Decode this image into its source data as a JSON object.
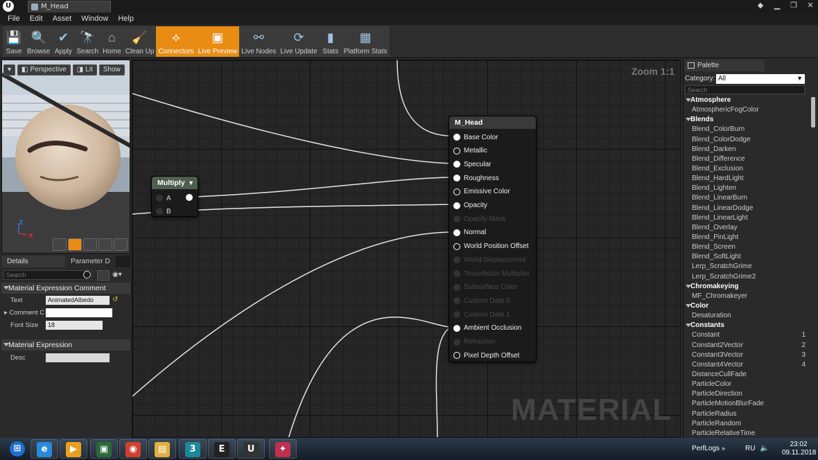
{
  "window": {
    "tab_title": "M_Head",
    "logo": "U"
  },
  "menu": [
    "File",
    "Edit",
    "Asset",
    "Window",
    "Help"
  ],
  "toolbar": [
    {
      "label": "Save",
      "icon": "save-icon",
      "active": false
    },
    {
      "label": "Browse",
      "icon": "browse-icon",
      "active": false
    },
    {
      "label": "Apply",
      "icon": "apply-icon",
      "active": false
    },
    {
      "label": "Search",
      "icon": "search-icon",
      "active": false
    },
    {
      "label": "Home",
      "icon": "home-icon",
      "active": false
    },
    {
      "label": "Clean Up",
      "icon": "cleanup-icon",
      "active": false
    },
    {
      "label": "Connectors",
      "icon": "connectors-icon",
      "active": true
    },
    {
      "label": "Live Preview",
      "icon": "live-preview-icon",
      "active": true
    },
    {
      "label": "Live Nodes",
      "icon": "live-nodes-icon",
      "active": false
    },
    {
      "label": "Live Update",
      "icon": "live-update-icon",
      "active": false
    },
    {
      "label": "Stats",
      "icon": "stats-icon",
      "active": false
    },
    {
      "label": "Platform Stats",
      "icon": "platform-stats-icon",
      "active": false
    }
  ],
  "viewport": {
    "perspective": "Perspective",
    "lit": "Lit",
    "show": "Show",
    "axis_z": "Z",
    "axis_x": "X"
  },
  "details": {
    "tab_details": "Details",
    "tab_params": "Parameter D",
    "search_placeholder": "Search",
    "section_comment": "Material Expression Comment",
    "text_label": "Text",
    "text_value": "AnimatedAlbedo",
    "comment_label": "Comment C",
    "font_size_label": "Font Size",
    "font_size_value": "18",
    "section_expression": "Material Expression",
    "desc_label": "Desc"
  },
  "graph": {
    "zoom": "Zoom 1:1",
    "watermark": "MATERIAL",
    "multiply_node": {
      "title": "Multiply",
      "pins": [
        "A",
        "B"
      ]
    },
    "result_node": {
      "title": "M_Head",
      "pins": [
        {
          "label": "Base Color",
          "state": "connected"
        },
        {
          "label": "Metallic",
          "state": "open"
        },
        {
          "label": "Specular",
          "state": "connected"
        },
        {
          "label": "Roughness",
          "state": "connected"
        },
        {
          "label": "Emissive Color",
          "state": "open"
        },
        {
          "label": "Opacity",
          "state": "connected"
        },
        {
          "label": "Opacity Mask",
          "state": "disabled"
        },
        {
          "label": "Normal",
          "state": "connected"
        },
        {
          "label": "World Position Offset",
          "state": "open"
        },
        {
          "label": "World Displacement",
          "state": "disabled"
        },
        {
          "label": "Tessellation Multiplier",
          "state": "disabled"
        },
        {
          "label": "Subsurface Color",
          "state": "disabled"
        },
        {
          "label": "Custom Data 0",
          "state": "disabled"
        },
        {
          "label": "Custom Data 1",
          "state": "disabled"
        },
        {
          "label": "Ambient Occlusion",
          "state": "connected"
        },
        {
          "label": "Refraction",
          "state": "disabled"
        },
        {
          "label": "Pixel Depth Offset",
          "state": "open"
        }
      ]
    }
  },
  "palette": {
    "tab": "Palette",
    "category_label": "Category:",
    "category_value": "All",
    "search_placeholder": "Search",
    "rows": [
      {
        "type": "cat",
        "label": "Atmosphere"
      },
      {
        "type": "item",
        "label": "AtmosphericFogColor"
      },
      {
        "type": "cat",
        "label": "Blends"
      },
      {
        "type": "item",
        "label": "Blend_ColorBurn"
      },
      {
        "type": "item",
        "label": "Blend_ColorDodge"
      },
      {
        "type": "item",
        "label": "Blend_Darken"
      },
      {
        "type": "item",
        "label": "Blend_Difference"
      },
      {
        "type": "item",
        "label": "Blend_Exclusion"
      },
      {
        "type": "item",
        "label": "Blend_HardLight"
      },
      {
        "type": "item",
        "label": "Blend_Lighten"
      },
      {
        "type": "item",
        "label": "Blend_LinearBurn"
      },
      {
        "type": "item",
        "label": "Blend_LinearDodge"
      },
      {
        "type": "item",
        "label": "Blend_LinearLight"
      },
      {
        "type": "item",
        "label": "Blend_Overlay"
      },
      {
        "type": "item",
        "label": "Blend_PinLight"
      },
      {
        "type": "item",
        "label": "Blend_Screen"
      },
      {
        "type": "item",
        "label": "Blend_SoftLight"
      },
      {
        "type": "item",
        "label": "Lerp_ScratchGrime"
      },
      {
        "type": "item",
        "label": "Lerp_ScratchGrime2"
      },
      {
        "type": "cat",
        "label": "Chromakeying"
      },
      {
        "type": "item",
        "label": "MF_Chromakeyer"
      },
      {
        "type": "cat",
        "label": "Color"
      },
      {
        "type": "item",
        "label": "Desaturation"
      },
      {
        "type": "cat",
        "label": "Constants"
      },
      {
        "type": "item",
        "label": "Constant",
        "key": "1"
      },
      {
        "type": "item",
        "label": "Constant2Vector",
        "key": "2"
      },
      {
        "type": "item",
        "label": "Constant3Vector",
        "key": "3"
      },
      {
        "type": "item",
        "label": "Constant4Vector",
        "key": "4"
      },
      {
        "type": "item",
        "label": "DistanceCullFade"
      },
      {
        "type": "item",
        "label": "ParticleColor"
      },
      {
        "type": "item",
        "label": "ParticleDirection"
      },
      {
        "type": "item",
        "label": "ParticleMotionBlurFade"
      },
      {
        "type": "item",
        "label": "ParticleRadius"
      },
      {
        "type": "item",
        "label": "ParticleRandom"
      },
      {
        "type": "item",
        "label": "ParticleRelativeTime"
      }
    ]
  },
  "taskbar": {
    "folder": "PerfLogs",
    "lang": "RU",
    "time": "23:02",
    "date": "09.11.2018",
    "apps": [
      "start-orb-icon",
      "ie-icon",
      "media-player-icon",
      "terminal-icon",
      "chrome-icon",
      "explorer-icon",
      "max-icon",
      "epic-games-icon",
      "unreal-icon",
      "game-icon"
    ]
  },
  "colors": {
    "accent": "#e88c14",
    "node_header": "#4f5f4f",
    "result_header": "#3a3a3a"
  }
}
